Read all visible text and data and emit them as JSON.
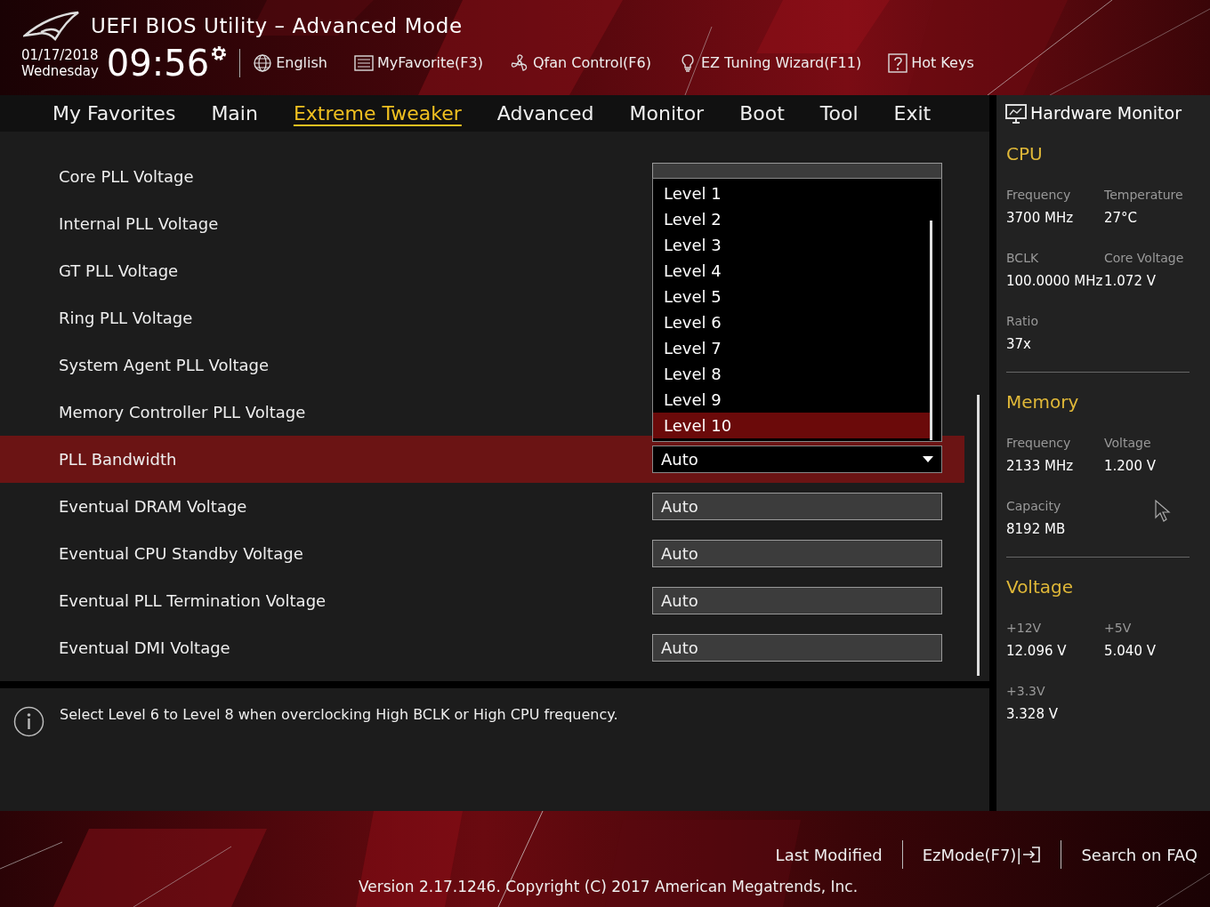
{
  "header": {
    "title": "UEFI BIOS Utility – Advanced Mode",
    "date": "01/17/2018",
    "day": "Wednesday",
    "time": "09:56",
    "tools": [
      {
        "kind": "globe",
        "label": "English"
      },
      {
        "kind": "list",
        "label": "MyFavorite(F3)"
      },
      {
        "kind": "fan",
        "label": "Qfan Control(F6)"
      },
      {
        "kind": "bulb",
        "label": "EZ Tuning Wizard(F11)"
      },
      {
        "kind": "help",
        "label": "Hot Keys"
      }
    ]
  },
  "tabs": [
    {
      "label": "My Favorites",
      "selected": false
    },
    {
      "label": "Main",
      "selected": false
    },
    {
      "label": "Extreme Tweaker",
      "selected": true
    },
    {
      "label": "Advanced",
      "selected": false
    },
    {
      "label": "Monitor",
      "selected": false
    },
    {
      "label": "Boot",
      "selected": false
    },
    {
      "label": "Tool",
      "selected": false
    },
    {
      "label": "Exit",
      "selected": false
    }
  ],
  "settings": [
    {
      "label": "Core PLL Voltage",
      "kind": "field",
      "selected": false
    },
    {
      "label": "Internal PLL Voltage",
      "selected": false
    },
    {
      "label": "GT PLL Voltage",
      "selected": false
    },
    {
      "label": "Ring PLL Voltage",
      "selected": false
    },
    {
      "label": "System Agent PLL Voltage",
      "selected": false
    },
    {
      "label": "Memory Controller PLL Voltage",
      "selected": false
    },
    {
      "label": "PLL Bandwidth",
      "kind": "field",
      "value": "Auto",
      "selected": true
    },
    {
      "label": "Eventual DRAM Voltage",
      "kind": "field",
      "value": "Auto",
      "selected": false
    },
    {
      "label": "Eventual CPU Standby Voltage",
      "kind": "field",
      "value": "Auto",
      "selected": false
    },
    {
      "label": "Eventual PLL Termination Voltage",
      "kind": "field",
      "value": "Auto",
      "selected": false
    },
    {
      "label": "Eventual DMI Voltage",
      "kind": "field",
      "value": "Auto",
      "selected": false
    }
  ],
  "dropdown": {
    "options": [
      {
        "label": "Level 1",
        "selected": false
      },
      {
        "label": "Level 2",
        "selected": false
      },
      {
        "label": "Level 3",
        "selected": false
      },
      {
        "label": "Level 4",
        "selected": false
      },
      {
        "label": "Level 5",
        "selected": false
      },
      {
        "label": "Level 6",
        "selected": false
      },
      {
        "label": "Level 7",
        "selected": false
      },
      {
        "label": "Level 8",
        "selected": false
      },
      {
        "label": "Level 9",
        "selected": false
      },
      {
        "label": "Level 10",
        "selected": true
      }
    ]
  },
  "help_text": "Select Level 6 to Level 8 when overclocking High BCLK or High CPU frequency.",
  "hardware_monitor": {
    "title": "Hardware Monitor",
    "sections": [
      {
        "title": "CPU",
        "items": [
          {
            "label": "Frequency",
            "value": "3700 MHz"
          },
          {
            "label": "Temperature",
            "value": "27°C"
          },
          {
            "label": "BCLK",
            "value": "100.0000 MHz"
          },
          {
            "label": "Core Voltage",
            "value": "1.072 V"
          },
          {
            "label": "Ratio",
            "value": "37x"
          }
        ]
      },
      {
        "title": "Memory",
        "items": [
          {
            "label": "Frequency",
            "value": "2133 MHz"
          },
          {
            "label": "Voltage",
            "value": "1.200 V"
          },
          {
            "label": "Capacity",
            "value": "8192 MB"
          }
        ]
      },
      {
        "title": "Voltage",
        "items": [
          {
            "label": "+12V",
            "value": "12.096 V"
          },
          {
            "label": "+5V",
            "value": "5.040 V"
          },
          {
            "label": "+3.3V",
            "value": "3.328 V"
          }
        ]
      }
    ]
  },
  "footer": {
    "buttons": [
      {
        "kind": "plain",
        "label": "Last Modified"
      },
      {
        "kind": "exit",
        "label": "EzMode(F7)|"
      },
      {
        "kind": "plain",
        "label": "Search on FAQ"
      }
    ],
    "version": "Version 2.17.1246. Copyright (C) 2017 American Megatrends, Inc."
  }
}
